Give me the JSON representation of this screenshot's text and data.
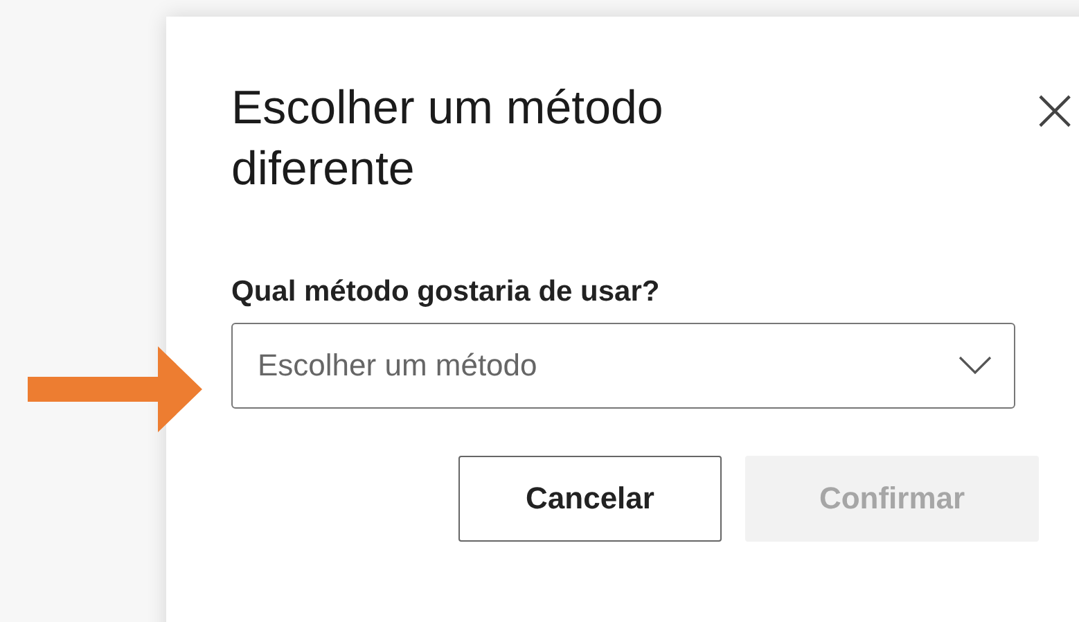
{
  "dialog": {
    "title": "Escolher um método diferente",
    "close": "×",
    "field": {
      "label": "Qual método gostaria de usar?",
      "placeholder": "Escolher um método"
    },
    "buttons": [
      {
        "label": "Cancelar",
        "kind": "secondary",
        "disabled": false
      },
      {
        "label": "Confirmar",
        "kind": "primary",
        "disabled": true
      }
    ]
  }
}
